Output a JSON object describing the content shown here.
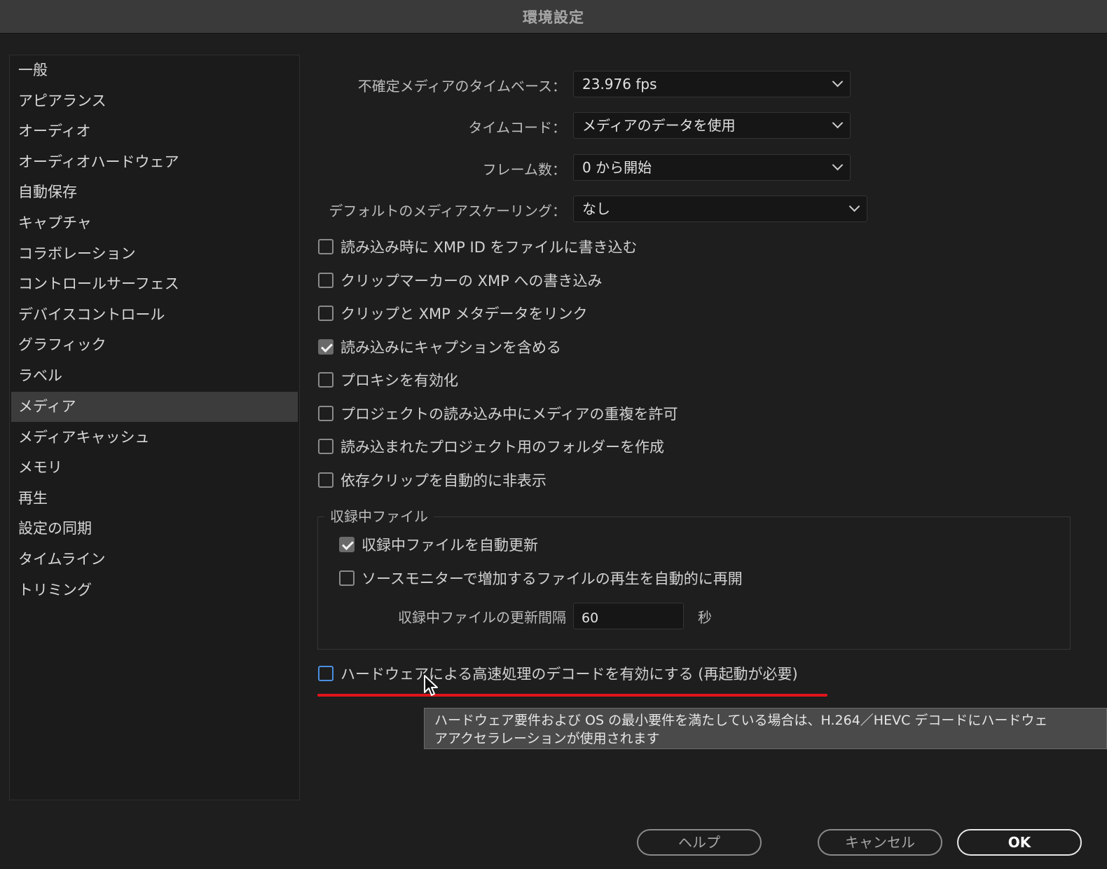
{
  "window": {
    "title": "環境設定"
  },
  "sidebar": {
    "items": [
      {
        "label": "一般"
      },
      {
        "label": "アピアランス"
      },
      {
        "label": "オーディオ"
      },
      {
        "label": "オーディオハードウェア"
      },
      {
        "label": "自動保存"
      },
      {
        "label": "キャプチャ"
      },
      {
        "label": "コラボレーション"
      },
      {
        "label": "コントロールサーフェス"
      },
      {
        "label": "デバイスコントロール"
      },
      {
        "label": "グラフィック"
      },
      {
        "label": "ラベル"
      },
      {
        "label": "メディア"
      },
      {
        "label": "メディアキャッシュ"
      },
      {
        "label": "メモリ"
      },
      {
        "label": "再生"
      },
      {
        "label": "設定の同期"
      },
      {
        "label": "タイムライン"
      },
      {
        "label": "トリミング"
      }
    ],
    "selected": "メディア"
  },
  "settings": {
    "timebase": {
      "label": "不確定メディアのタイムベース：",
      "value": "23.976 fps"
    },
    "timecode": {
      "label": "タイムコード：",
      "value": "メディアのデータを使用"
    },
    "frame_count": {
      "label": "フレーム数：",
      "value": "0 から開始"
    },
    "scaling": {
      "label": "デフォルトのメディアスケーリング：",
      "value": "なし"
    }
  },
  "checkboxes": [
    {
      "label": "読み込み時に XMP ID をファイルに書き込む",
      "checked": false
    },
    {
      "label": "クリップマーカーの XMP への書き込み",
      "checked": false
    },
    {
      "label": "クリップと XMP メタデータをリンク",
      "checked": false
    },
    {
      "label": "読み込みにキャプションを含める",
      "checked": true
    },
    {
      "label": "プロキシを有効化",
      "checked": false
    },
    {
      "label": "プロジェクトの読み込み中にメディアの重複を許可",
      "checked": false
    },
    {
      "label": "読み込まれたプロジェクト用のフォルダーを作成",
      "checked": false
    },
    {
      "label": "依存クリップを自動的に非表示",
      "checked": false
    }
  ],
  "growing_files": {
    "title": "収録中ファイル",
    "auto_refresh": {
      "label": "収録中ファイルを自動更新",
      "checked": true
    },
    "resume_playback": {
      "label": "ソースモニターで増加するファイルの再生を自動的に再開",
      "checked": false
    },
    "interval_label": "収録中ファイルの更新間隔",
    "interval_value": "60",
    "interval_unit": "秒"
  },
  "hardware_decode": {
    "label": "ハードウェアによる高速処理のデコードを有効にする (再起動が必要)",
    "checked": false
  },
  "tooltip": {
    "line1": "ハードウェア要件および OS の最小要件を満たしている場合は、H.264／HEVC デコードにハードウェ",
    "line2": "アアクセラレーションが使用されます"
  },
  "buttons": {
    "help": "ヘルプ",
    "cancel": "キャンセル",
    "ok": "OK"
  },
  "colors": {
    "annotation_underline": "#e0141b",
    "focus": "#4a8fe0"
  }
}
